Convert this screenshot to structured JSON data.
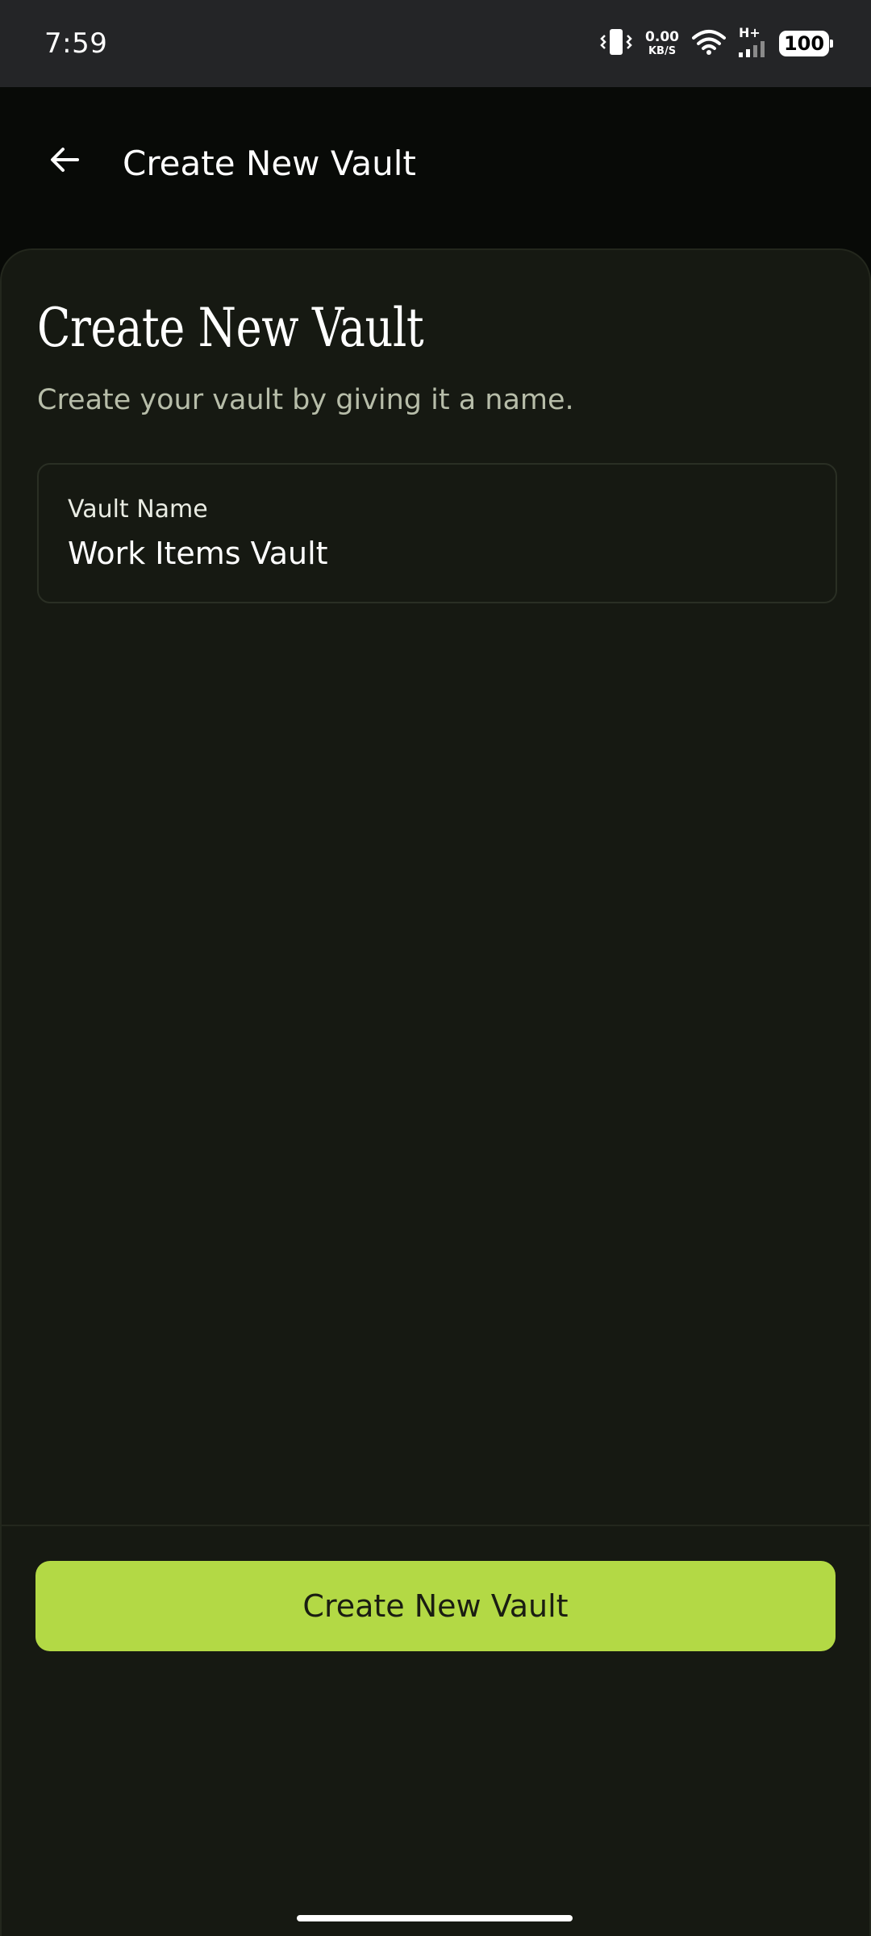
{
  "status_bar": {
    "time": "7:59",
    "net_speed_value": "0.00",
    "net_speed_unit": "KB/S",
    "network_type": "H+",
    "battery_level": "100",
    "icons": [
      "vibrate-icon",
      "wifi-icon",
      "signal-icon",
      "battery-icon"
    ]
  },
  "app_bar": {
    "title": "Create New Vault",
    "back_icon": "arrow-left-icon"
  },
  "content": {
    "heading": "Create New Vault",
    "subtitle": "Create your vault by giving it a name.",
    "vault_name_field": {
      "label": "Vault Name",
      "value": "Work Items Vault"
    }
  },
  "footer": {
    "primary_button_label": "Create New Vault"
  },
  "colors": {
    "accent": "#b3d945",
    "background": "#080a07",
    "surface": "#161912",
    "status_bar": "#242527",
    "subtitle_text": "#b7bda9"
  }
}
